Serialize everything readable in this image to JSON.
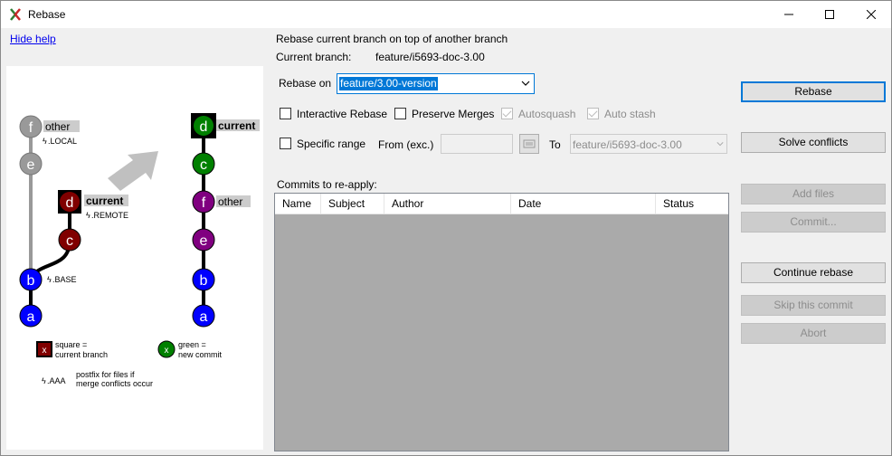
{
  "window": {
    "title": "Rebase",
    "controls": {
      "minimize": "minimize-icon",
      "maximize": "maximize-icon",
      "close": "close-icon"
    }
  },
  "help": {
    "toggle_label": "Hide help",
    "left_diagram": {
      "nodes": [
        {
          "letter": "f",
          "label": "other",
          "sub": ".LOCAL"
        },
        {
          "letter": "e"
        },
        {
          "letter": "d",
          "label": "current",
          "sub": ".REMOTE"
        },
        {
          "letter": "c"
        },
        {
          "letter": "b",
          "sub": ".BASE"
        },
        {
          "letter": "a"
        }
      ]
    },
    "right_diagram": {
      "nodes": [
        {
          "letter": "d",
          "label": "current"
        },
        {
          "letter": "c"
        },
        {
          "letter": "f",
          "label": "other"
        },
        {
          "letter": "e"
        },
        {
          "letter": "b"
        },
        {
          "letter": "a"
        }
      ]
    },
    "legend": {
      "square_marker": "x",
      "square_text_1": "square =",
      "square_text_2": "current branch",
      "green_marker": "x",
      "green_text_1": "green =",
      "green_text_2": "new commit",
      "postfix_marker": ".AAA",
      "postfix_text_1": "postfix for files if",
      "postfix_text_2": "merge conflicts occur"
    },
    "colors": {
      "gray": "#999999",
      "red": "#800000",
      "green": "#008000",
      "purple": "#800080",
      "blue": "#0000ff",
      "arrow": "#c0c0c0"
    }
  },
  "form": {
    "heading": "Rebase current branch on top of another branch",
    "current_branch_label": "Current branch:",
    "current_branch_value": "feature/i5693-doc-3.00",
    "rebase_on_label": "Rebase on",
    "rebase_on_value": "feature/3.00-version",
    "options": {
      "interactive_rebase": "Interactive Rebase",
      "preserve_merges": "Preserve Merges",
      "autosquash": "Autosquash",
      "auto_stash": "Auto stash"
    },
    "specific_range": "Specific range",
    "from_label": "From (exc.)",
    "from_value": "",
    "to_label": "To",
    "to_value": "feature/i5693-doc-3.00",
    "commits_label": "Commits to re-apply:",
    "columns": [
      "Name",
      "Subject",
      "Author",
      "Date",
      "Status"
    ]
  },
  "actions": {
    "rebase": "Rebase",
    "solve_conflicts": "Solve conflicts",
    "add_files": "Add files",
    "commit": "Commit...",
    "continue_rebase": "Continue rebase",
    "skip_commit": "Skip this commit",
    "abort": "Abort"
  },
  "accent": "#0078d7"
}
